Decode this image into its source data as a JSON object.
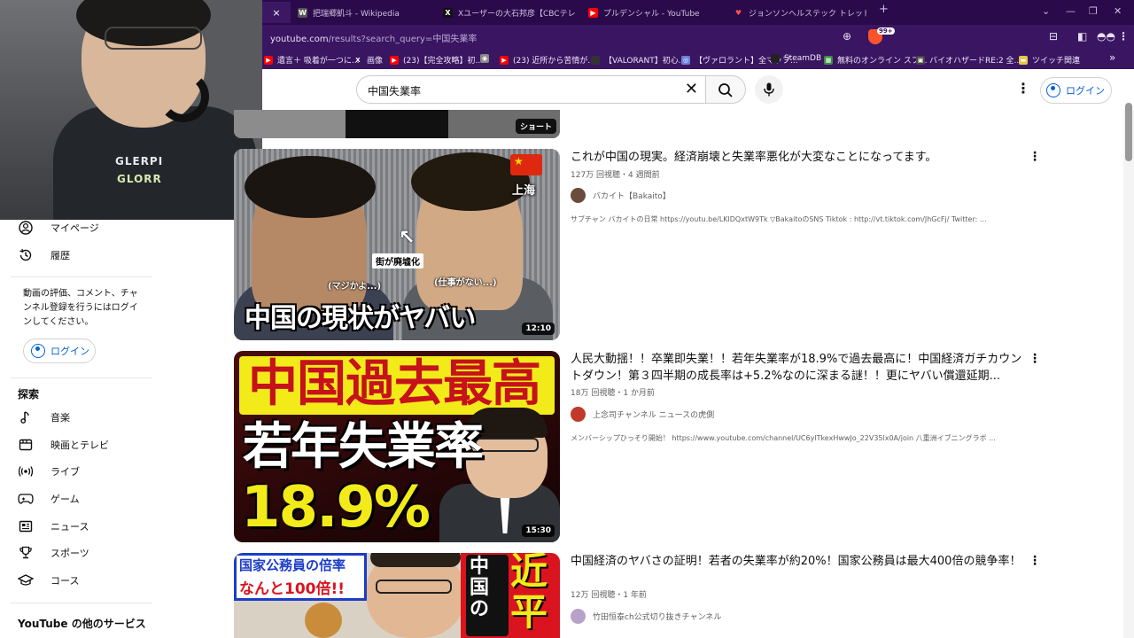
{
  "browser": {
    "tabs": [
      {
        "title": "",
        "close": "×",
        "color": "#3c1864"
      },
      {
        "title": "把瑞郷凱斗 - Wikipedia",
        "fav": "W",
        "fav_color": "#ffffff",
        "fav_bg": "#555"
      },
      {
        "title": "Xユーザーの大石邦彦【CBCテレビ解説委",
        "fav": "X",
        "fav_color": "#ffffff",
        "fav_bg": "#111"
      },
      {
        "title": "プルデンシャル - YouTube",
        "fav": "▶",
        "fav_color": "#ffffff",
        "fav_bg": "#ff0000"
      },
      {
        "title": "ジョンソンヘルステック トレッドミル 業務用",
        "fav": "♥",
        "fav_color": "#ff4d4d",
        "fav_bg": "transparent"
      }
    ],
    "new_tab": "+",
    "window_controls": [
      "⌄",
      "—",
      "❐",
      "✕"
    ],
    "url_host": "youtube.com",
    "url_path": "/results?search_query=中国失業率",
    "brave_badge": "99+",
    "bookmarks": [
      {
        "label": "遺言＋ 吸着が一つに...",
        "fav_bg": "#ff0000",
        "fav": "▶"
      },
      {
        "label": "画像",
        "fav_bg": "transparent",
        "fav": "X"
      },
      {
        "label": "(23)【完全攻略】初...",
        "fav_bg": "#ff0000",
        "fav": "▶"
      },
      {
        "label": "",
        "fav_bg": "#888",
        "fav": "◉"
      },
      {
        "label": "(23) 近所から苦情が...",
        "fav_bg": "#ff0000",
        "fav": "▶"
      },
      {
        "label": "【VALORANT】初心...",
        "fav_bg": "#333",
        "fav": ""
      },
      {
        "label": "【ヴァロラント】全マップ...",
        "fav_bg": "#6a7fd6",
        "fav": "◎"
      },
      {
        "label": "SteamDB",
        "fav_bg": "#222",
        "fav": ""
      },
      {
        "label": "無料のオンライン スプ...",
        "fav_bg": "#3b8d3f",
        "fav": "▦"
      },
      {
        "label": "バイオハザードRE:2 全...",
        "fav_bg": "#444",
        "fav": "▣"
      },
      {
        "label": "ツイッチ関連",
        "fav_bg": "#e8c547",
        "fav": "▬"
      }
    ],
    "bookmarks_more": "»"
  },
  "youtube": {
    "search_query": "中国失業率",
    "login_label": "ログイン"
  },
  "sidebar": {
    "items_top": [
      {
        "label": "マイページ",
        "icon": "user-icon"
      },
      {
        "label": "履歴",
        "icon": "history-icon"
      }
    ],
    "note": "動画の評価、コメント、チャンネル登録を行うにはログインしてください。",
    "login_label": "ログイン",
    "explore_heading": "探索",
    "explore_items": [
      {
        "label": "音楽",
        "icon": "music-icon"
      },
      {
        "label": "映画とテレビ",
        "icon": "film-icon"
      },
      {
        "label": "ライブ",
        "icon": "live-icon"
      },
      {
        "label": "ゲーム",
        "icon": "game-icon"
      },
      {
        "label": "ニュース",
        "icon": "news-icon"
      },
      {
        "label": "スポーツ",
        "icon": "trophy-icon"
      },
      {
        "label": "コース",
        "icon": "course-icon"
      }
    ],
    "more_heading": "YouTube の他のサービス"
  },
  "results": {
    "shorts_badge": "ショート",
    "videos": [
      {
        "title": "これが中国の現実。経済崩壊と失業率悪化が大変なことになってます。",
        "meta": "127万 回視聴・4 週間前",
        "channel": "バカイト【Bakaito】",
        "avatar_color": "#6b4b3a",
        "desc": "サブチャン バカイトの日常 https://youtu.be/LKlDQxtW9Tk ▽BakaitoのSNS Tiktok : http://vt.tiktok.com/JhGcFj/ Twitter: ...",
        "duration": "12:10",
        "thumb": {
          "shanghai": "上海",
          "street": "街が廃墟化",
          "left_caption": "(マジかよ...)",
          "right_caption": "(仕事がない...)",
          "big": "中国の現状がヤバい"
        }
      },
      {
        "title": "人民大動揺！！卒業即失業！！若年失業率が18.9%で過去最高に！中国経済ガチカウントダウン！第３四半期の成長率は+5.2%なのに深まる謎！！更にヤバい償還延期...",
        "meta": "18万 回視聴・1 か月前",
        "channel": "上念司チャンネル ニュースの虎側",
        "avatar_color": "#c0392b",
        "desc": "メンバーシップひっそり開始！ https://www.youtube.com/channel/UC6ylTkexHwwJo_22V35lx0A/join 八重洲イブニングラボ ...",
        "duration": "15:30",
        "thumb": {
          "row1": "中国過去最高",
          "row2": "若年失業率",
          "row3": "18.9%"
        }
      },
      {
        "title": "中国経済のヤバさの証明！若者の失業率が約20%！国家公務員は最大400倍の競争率！",
        "meta": "12万 回視聴・1 年前",
        "channel": "竹田恒泰ch公式切り抜きチャンネル",
        "avatar_color": "#b9a2c9",
        "desc": "",
        "duration": "",
        "thumb": {
          "box1": "国家公務員の倍率",
          "box2": "なんと100倍!!",
          "red1": "中国の",
          "red2": "近平"
        }
      }
    ]
  },
  "webcam": {
    "shirt_line1": "GLERPI",
    "shirt_line2": "GLORR"
  }
}
